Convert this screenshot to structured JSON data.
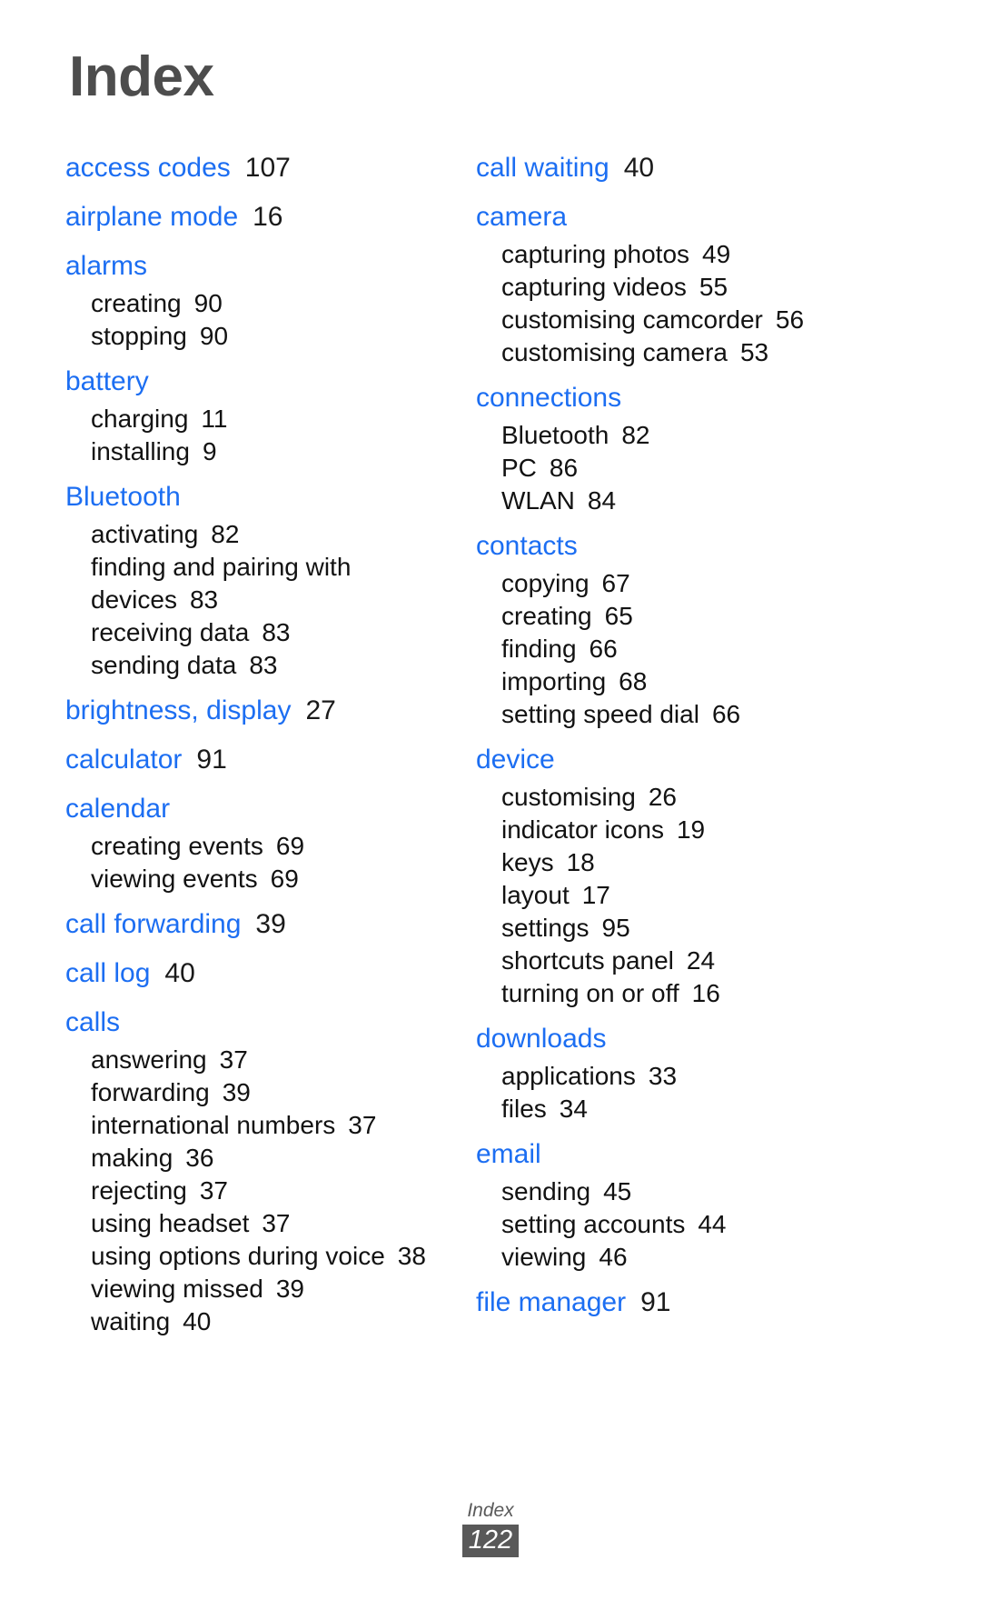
{
  "document": {
    "title": "Index",
    "title_color": "#4d4d4d",
    "term_color": "#1c6ef2",
    "page_color": "#1a1a1a"
  },
  "footer": {
    "label": "Index",
    "page_number": "122",
    "badge_color": "#595959"
  },
  "columns": [
    {
      "name": "left-column",
      "groups": [
        {
          "term": "access codes",
          "page": "107",
          "subs": []
        },
        {
          "term": "airplane mode",
          "page": "16",
          "subs": []
        },
        {
          "term": "alarms",
          "page": "",
          "subs": [
            {
              "label": "creating",
              "page": "90"
            },
            {
              "label": "stopping",
              "page": "90"
            }
          ]
        },
        {
          "term": "battery",
          "page": "",
          "subs": [
            {
              "label": "charging",
              "page": "11"
            },
            {
              "label": "installing",
              "page": "9"
            }
          ]
        },
        {
          "term": "Bluetooth",
          "page": "",
          "subs": [
            {
              "label": "activating",
              "page": "82"
            },
            {
              "label": "finding and pairing with devices",
              "page": "83"
            },
            {
              "label": "receiving data",
              "page": "83"
            },
            {
              "label": "sending data",
              "page": "83"
            }
          ]
        },
        {
          "term": "brightness, display",
          "page": "27",
          "subs": []
        },
        {
          "term": "calculator",
          "page": "91",
          "subs": []
        },
        {
          "term": "calendar",
          "page": "",
          "subs": [
            {
              "label": "creating events",
              "page": "69"
            },
            {
              "label": "viewing events",
              "page": "69"
            }
          ]
        },
        {
          "term": "call forwarding",
          "page": "39",
          "subs": []
        },
        {
          "term": "call log",
          "page": "40",
          "subs": []
        },
        {
          "term": "calls",
          "page": "",
          "subs": [
            {
              "label": "answering",
              "page": "37"
            },
            {
              "label": "forwarding",
              "page": "39"
            },
            {
              "label": "international numbers",
              "page": "37"
            },
            {
              "label": "making",
              "page": "36"
            },
            {
              "label": "rejecting",
              "page": "37"
            },
            {
              "label": "using headset",
              "page": "37"
            },
            {
              "label": "using options during voice",
              "page": "38"
            },
            {
              "label": "viewing missed",
              "page": "39"
            },
            {
              "label": "waiting",
              "page": "40"
            }
          ]
        }
      ]
    },
    {
      "name": "right-column",
      "groups": [
        {
          "term": "call waiting",
          "page": "40",
          "subs": []
        },
        {
          "term": "camera",
          "page": "",
          "subs": [
            {
              "label": "capturing photos",
              "page": "49"
            },
            {
              "label": "capturing videos",
              "page": "55"
            },
            {
              "label": "customising camcorder",
              "page": "56"
            },
            {
              "label": "customising camera",
              "page": "53"
            }
          ]
        },
        {
          "term": "connections",
          "page": "",
          "subs": [
            {
              "label": "Bluetooth",
              "page": "82"
            },
            {
              "label": "PC",
              "page": "86"
            },
            {
              "label": "WLAN",
              "page": "84"
            }
          ]
        },
        {
          "term": "contacts",
          "page": "",
          "subs": [
            {
              "label": "copying",
              "page": "67"
            },
            {
              "label": "creating",
              "page": "65"
            },
            {
              "label": "finding",
              "page": "66"
            },
            {
              "label": "importing",
              "page": "68"
            },
            {
              "label": "setting speed dial",
              "page": "66"
            }
          ]
        },
        {
          "term": "device",
          "page": "",
          "subs": [
            {
              "label": "customising",
              "page": "26"
            },
            {
              "label": "indicator icons",
              "page": "19"
            },
            {
              "label": "keys",
              "page": "18"
            },
            {
              "label": "layout",
              "page": "17"
            },
            {
              "label": "settings",
              "page": "95"
            },
            {
              "label": "shortcuts panel",
              "page": "24"
            },
            {
              "label": "turning on or off",
              "page": "16"
            }
          ]
        },
        {
          "term": "downloads",
          "page": "",
          "subs": [
            {
              "label": "applications",
              "page": "33"
            },
            {
              "label": "files",
              "page": "34"
            }
          ]
        },
        {
          "term": "email",
          "page": "",
          "subs": [
            {
              "label": "sending",
              "page": "45"
            },
            {
              "label": "setting accounts",
              "page": "44"
            },
            {
              "label": "viewing",
              "page": "46"
            }
          ]
        },
        {
          "term": "file manager",
          "page": "91",
          "subs": []
        }
      ]
    }
  ]
}
